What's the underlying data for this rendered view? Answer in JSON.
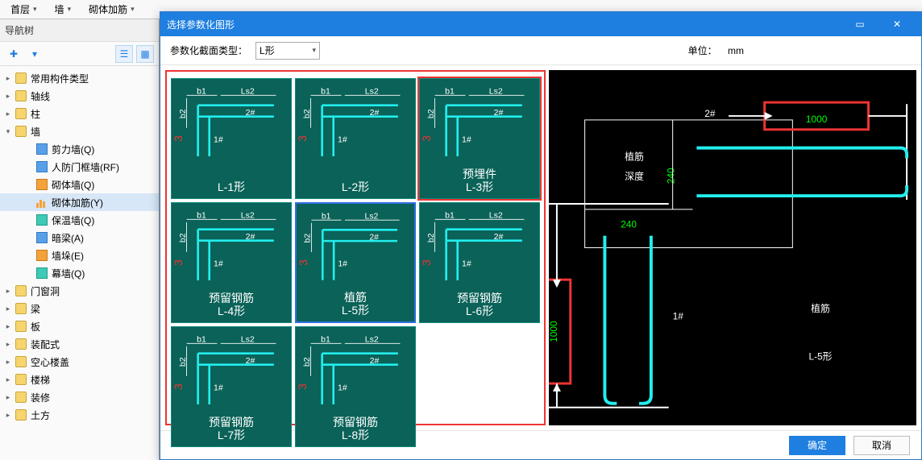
{
  "toolbar": {
    "item1": "首层",
    "item2": "墙",
    "item3": "砌体加筋"
  },
  "nav": {
    "title": "导航树",
    "tree": [
      {
        "label": "常用构件类型",
        "depth": 0,
        "toggle": "▸",
        "icon": "folder"
      },
      {
        "label": "轴线",
        "depth": 0,
        "toggle": "▸",
        "icon": "folder"
      },
      {
        "label": "柱",
        "depth": 0,
        "toggle": "▸",
        "icon": "folder"
      },
      {
        "label": "墙",
        "depth": 0,
        "toggle": "▾",
        "icon": "folder"
      },
      {
        "label": "剪力墙(Q)",
        "depth": 1,
        "toggle": "",
        "icon": "blue"
      },
      {
        "label": "人防门框墙(RF)",
        "depth": 1,
        "toggle": "",
        "icon": "blue"
      },
      {
        "label": "砌体墙(Q)",
        "depth": 1,
        "toggle": "",
        "icon": "orange"
      },
      {
        "label": "砌体加筋(Y)",
        "depth": 1,
        "toggle": "",
        "icon": "bars",
        "sel": true
      },
      {
        "label": "保温墙(Q)",
        "depth": 1,
        "toggle": "",
        "icon": "teal"
      },
      {
        "label": "暗梁(A)",
        "depth": 1,
        "toggle": "",
        "icon": "blue"
      },
      {
        "label": "墙垛(E)",
        "depth": 1,
        "toggle": "",
        "icon": "orange"
      },
      {
        "label": "幕墙(Q)",
        "depth": 1,
        "toggle": "",
        "icon": "teal"
      },
      {
        "label": "门窗洞",
        "depth": 0,
        "toggle": "▸",
        "icon": "folder"
      },
      {
        "label": "梁",
        "depth": 0,
        "toggle": "▸",
        "icon": "folder"
      },
      {
        "label": "板",
        "depth": 0,
        "toggle": "▸",
        "icon": "folder"
      },
      {
        "label": "装配式",
        "depth": 0,
        "toggle": "▸",
        "icon": "folder"
      },
      {
        "label": "空心楼盖",
        "depth": 0,
        "toggle": "▸",
        "icon": "folder"
      },
      {
        "label": "楼梯",
        "depth": 0,
        "toggle": "▸",
        "icon": "folder"
      },
      {
        "label": "装修",
        "depth": 0,
        "toggle": "▸",
        "icon": "folder"
      },
      {
        "label": "土方",
        "depth": 0,
        "toggle": "▸",
        "icon": "folder"
      }
    ]
  },
  "dialog": {
    "title": "选择参数化图形",
    "paramLabel": "参数化截面类型：",
    "paramValue": "L形",
    "unitLabel": "单位：",
    "unitValue": "mm",
    "ok": "确定",
    "cancel": "取消"
  },
  "thumbs": [
    {
      "line1": "",
      "line2": "L-1形",
      "star": false,
      "sel": false
    },
    {
      "line1": "",
      "line2": "L-2形",
      "star": false,
      "sel": false
    },
    {
      "line1": "预埋件",
      "line2": "L-3形",
      "star": true,
      "sel": false
    },
    {
      "line1": "预留钢筋",
      "line2": "L-4形",
      "star": false,
      "sel": false
    },
    {
      "line1": "植筋",
      "line2": "L-5形",
      "star": false,
      "sel": true
    },
    {
      "line1": "预留钢筋",
      "line2": "L-6形",
      "star": false,
      "sel": false
    },
    {
      "line1": "预留钢筋",
      "line2": "L-7形",
      "star": false,
      "sel": false
    },
    {
      "line1": "预留钢筋",
      "line2": "L-8形",
      "star": false,
      "sel": false
    }
  ],
  "thumbAnnots": {
    "b1": "b1",
    "b2": "b2",
    "ls2": "Ls2",
    "n1": "1#",
    "n2": "2#",
    "n3": "3#",
    "zj": "植筋\n深度",
    "red3": "3"
  },
  "preview": {
    "title1": "植筋",
    "title2": "L-5形",
    "depthLabel": "植筋\n深度",
    "v1000a": "1000",
    "v1000b": "1000",
    "v240a": "240",
    "v240b": "240",
    "tag1": "1#",
    "tag2": "2#"
  }
}
